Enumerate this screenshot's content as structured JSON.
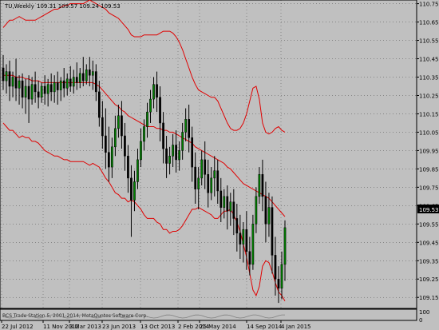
{
  "header": {
    "symbol_timeframe": "TU,Weekly",
    "ohlc": "109.31 109.57 109.24 109.53"
  },
  "footer": {
    "indicator_text": "BCS Trade Station 5, 2001-2014, MetaQuotes Software Corp."
  },
  "chart_data": {
    "type": "candlestick",
    "title": "TU,Weekly",
    "current_price": "109.53",
    "price_axis_ticks": [
      "110.75",
      "110.65",
      "110.55",
      "110.45",
      "110.35",
      "110.25",
      "110.15",
      "110.05",
      "109.95",
      "109.85",
      "109.75",
      "109.65",
      "109.55",
      "109.45",
      "109.35",
      "109.25",
      "109.15"
    ],
    "time_axis_ticks": [
      "22 Jul 2012",
      "11 Nov 2012",
      "3 Mar 2013",
      "23 Jun 2013",
      "13 Oct 2013",
      "2 Feb 2014",
      "25 May 2014",
      "14 Sep 2014",
      "4 Jan 2015"
    ],
    "subwindow_ticks": [
      "100",
      "0"
    ],
    "ylim": [
      109.09,
      110.77
    ],
    "candles": [
      {
        "o": 110.4,
        "h": 110.47,
        "c": 110.33,
        "l": 110.28
      },
      {
        "o": 110.33,
        "h": 110.42,
        "c": 110.38,
        "l": 110.26
      },
      {
        "o": 110.38,
        "h": 110.44,
        "c": 110.3,
        "l": 110.22
      },
      {
        "o": 110.3,
        "h": 110.38,
        "c": 110.35,
        "l": 110.24
      },
      {
        "o": 110.35,
        "h": 110.45,
        "c": 110.29,
        "l": 110.22
      },
      {
        "o": 110.29,
        "h": 110.36,
        "c": 110.33,
        "l": 110.2
      },
      {
        "o": 110.33,
        "h": 110.37,
        "c": 110.24,
        "l": 110.18
      },
      {
        "o": 110.24,
        "h": 110.34,
        "c": 110.3,
        "l": 110.15
      },
      {
        "o": 110.3,
        "h": 110.36,
        "c": 110.23,
        "l": 110.1
      },
      {
        "o": 110.23,
        "h": 110.35,
        "c": 110.31,
        "l": 110.2
      },
      {
        "o": 110.31,
        "h": 110.38,
        "c": 110.27,
        "l": 110.21
      },
      {
        "o": 110.27,
        "h": 110.33,
        "c": 110.24,
        "l": 110.18
      },
      {
        "o": 110.24,
        "h": 110.32,
        "c": 110.3,
        "l": 110.21
      },
      {
        "o": 110.3,
        "h": 110.36,
        "c": 110.26,
        "l": 110.2
      },
      {
        "o": 110.26,
        "h": 110.34,
        "c": 110.31,
        "l": 110.19
      },
      {
        "o": 110.31,
        "h": 110.37,
        "c": 110.27,
        "l": 110.22
      },
      {
        "o": 110.27,
        "h": 110.36,
        "c": 110.32,
        "l": 110.21
      },
      {
        "o": 110.32,
        "h": 110.38,
        "c": 110.28,
        "l": 110.2
      },
      {
        "o": 110.28,
        "h": 110.35,
        "c": 110.33,
        "l": 110.22
      },
      {
        "o": 110.33,
        "h": 110.4,
        "c": 110.29,
        "l": 110.24
      },
      {
        "o": 110.29,
        "h": 110.37,
        "c": 110.34,
        "l": 110.25
      },
      {
        "o": 110.34,
        "h": 110.41,
        "c": 110.3,
        "l": 110.27
      },
      {
        "o": 110.3,
        "h": 110.39,
        "c": 110.35,
        "l": 110.26
      },
      {
        "o": 110.35,
        "h": 110.43,
        "c": 110.32,
        "l": 110.28
      },
      {
        "o": 110.32,
        "h": 110.4,
        "c": 110.37,
        "l": 110.29
      },
      {
        "o": 110.37,
        "h": 110.46,
        "c": 110.33,
        "l": 110.3
      },
      {
        "o": 110.33,
        "h": 110.42,
        "c": 110.39,
        "l": 110.31
      },
      {
        "o": 110.39,
        "h": 110.46,
        "c": 110.36,
        "l": 110.3
      },
      {
        "o": 110.36,
        "h": 110.44,
        "c": 110.38,
        "l": 110.28
      },
      {
        "o": 110.38,
        "h": 110.42,
        "c": 110.27,
        "l": 110.22
      },
      {
        "o": 110.27,
        "h": 110.33,
        "c": 110.13,
        "l": 110.08
      },
      {
        "o": 110.13,
        "h": 110.22,
        "c": 110.03,
        "l": 109.96
      },
      {
        "o": 110.03,
        "h": 110.18,
        "c": 109.94,
        "l": 109.85
      },
      {
        "o": 109.94,
        "h": 110.08,
        "c": 109.86,
        "l": 109.78
      },
      {
        "o": 109.86,
        "h": 110.02,
        "c": 109.97,
        "l": 109.8
      },
      {
        "o": 109.97,
        "h": 110.14,
        "c": 110.07,
        "l": 109.92
      },
      {
        "o": 110.07,
        "h": 110.2,
        "c": 110.14,
        "l": 110.02
      },
      {
        "o": 110.14,
        "h": 110.22,
        "c": 110.03,
        "l": 109.96
      },
      {
        "o": 110.03,
        "h": 110.1,
        "c": 109.92,
        "l": 109.84
      },
      {
        "o": 109.92,
        "h": 109.98,
        "c": 109.8,
        "l": 109.72
      },
      {
        "o": 109.8,
        "h": 109.87,
        "c": 109.68,
        "l": 109.48
      },
      {
        "o": 109.68,
        "h": 109.84,
        "c": 109.78,
        "l": 109.62
      },
      {
        "o": 109.78,
        "h": 109.96,
        "c": 109.9,
        "l": 109.74
      },
      {
        "o": 109.9,
        "h": 110.07,
        "c": 110.0,
        "l": 109.86
      },
      {
        "o": 110.0,
        "h": 110.12,
        "c": 110.08,
        "l": 109.95
      },
      {
        "o": 110.08,
        "h": 110.21,
        "c": 110.16,
        "l": 110.02
      },
      {
        "o": 110.16,
        "h": 110.28,
        "c": 110.23,
        "l": 110.1
      },
      {
        "o": 110.23,
        "h": 110.35,
        "c": 110.31,
        "l": 110.18
      },
      {
        "o": 110.31,
        "h": 110.38,
        "c": 110.24,
        "l": 110.16
      },
      {
        "o": 110.24,
        "h": 110.3,
        "c": 110.1,
        "l": 110.0
      },
      {
        "o": 110.1,
        "h": 110.16,
        "c": 109.96,
        "l": 109.88
      },
      {
        "o": 109.96,
        "h": 110.03,
        "c": 109.88,
        "l": 109.8
      },
      {
        "o": 109.88,
        "h": 109.97,
        "c": 109.92,
        "l": 109.82
      },
      {
        "o": 109.92,
        "h": 110.04,
        "c": 109.98,
        "l": 109.86
      },
      {
        "o": 109.98,
        "h": 110.06,
        "c": 109.9,
        "l": 109.83
      },
      {
        "o": 109.9,
        "h": 110.0,
        "c": 109.95,
        "l": 109.84
      },
      {
        "o": 109.95,
        "h": 110.1,
        "c": 110.05,
        "l": 109.9
      },
      {
        "o": 110.05,
        "h": 110.18,
        "c": 110.12,
        "l": 110.0
      },
      {
        "o": 110.12,
        "h": 110.2,
        "c": 110.02,
        "l": 109.94
      },
      {
        "o": 110.02,
        "h": 110.08,
        "c": 109.86,
        "l": 109.78
      },
      {
        "o": 109.86,
        "h": 109.94,
        "c": 109.74,
        "l": 109.66
      },
      {
        "o": 109.74,
        "h": 109.86,
        "c": 109.8,
        "l": 109.63
      },
      {
        "o": 109.8,
        "h": 109.95,
        "c": 109.9,
        "l": 109.76
      },
      {
        "o": 109.9,
        "h": 110.0,
        "c": 109.82,
        "l": 109.74
      },
      {
        "o": 109.82,
        "h": 109.9,
        "c": 109.72,
        "l": 109.64
      },
      {
        "o": 109.72,
        "h": 109.86,
        "c": 109.8,
        "l": 109.68
      },
      {
        "o": 109.8,
        "h": 109.92,
        "c": 109.84,
        "l": 109.7
      },
      {
        "o": 109.84,
        "h": 109.9,
        "c": 109.73,
        "l": 109.66
      },
      {
        "o": 109.73,
        "h": 109.8,
        "c": 109.64,
        "l": 109.56
      },
      {
        "o": 109.64,
        "h": 109.74,
        "c": 109.7,
        "l": 109.58
      },
      {
        "o": 109.7,
        "h": 109.76,
        "c": 109.62,
        "l": 109.52
      },
      {
        "o": 109.62,
        "h": 109.72,
        "c": 109.67,
        "l": 109.54
      },
      {
        "o": 109.67,
        "h": 109.74,
        "c": 109.58,
        "l": 109.49
      },
      {
        "o": 109.58,
        "h": 109.66,
        "c": 109.5,
        "l": 109.4
      },
      {
        "o": 109.5,
        "h": 109.6,
        "c": 109.44,
        "l": 109.36
      },
      {
        "o": 109.44,
        "h": 109.56,
        "c": 109.52,
        "l": 109.34
      },
      {
        "o": 109.52,
        "h": 109.62,
        "c": 109.4,
        "l": 109.3
      },
      {
        "o": 109.4,
        "h": 109.48,
        "c": 109.33,
        "l": 109.27
      },
      {
        "o": 109.33,
        "h": 109.6,
        "c": 109.55,
        "l": 109.3
      },
      {
        "o": 109.55,
        "h": 109.75,
        "c": 109.7,
        "l": 109.5
      },
      {
        "o": 109.7,
        "h": 109.86,
        "c": 109.82,
        "l": 109.66
      },
      {
        "o": 109.82,
        "h": 109.9,
        "c": 109.7,
        "l": 109.62
      },
      {
        "o": 109.7,
        "h": 109.78,
        "c": 109.55,
        "l": 109.45
      },
      {
        "o": 109.55,
        "h": 109.72,
        "c": 109.64,
        "l": 109.48
      },
      {
        "o": 109.64,
        "h": 109.7,
        "c": 109.38,
        "l": 109.28
      },
      {
        "o": 109.38,
        "h": 109.48,
        "c": 109.25,
        "l": 109.16
      },
      {
        "o": 109.25,
        "h": 109.32,
        "c": 109.2,
        "l": 109.12
      },
      {
        "o": 109.2,
        "h": 109.4,
        "c": 109.33,
        "l": 109.14
      },
      {
        "o": 109.33,
        "h": 109.57,
        "c": 109.53,
        "l": 109.24
      }
    ],
    "bands": {
      "upper": [
        110.62,
        110.64,
        110.66,
        110.66,
        110.67,
        110.68,
        110.67,
        110.66,
        110.66,
        110.66,
        110.66,
        110.67,
        110.68,
        110.69,
        110.7,
        110.71,
        110.72,
        110.72,
        110.73,
        110.74,
        110.74,
        110.75,
        110.75,
        110.75,
        110.75,
        110.75,
        110.76,
        110.77,
        110.76,
        110.75,
        110.74,
        110.73,
        110.72,
        110.7,
        110.69,
        110.68,
        110.67,
        110.65,
        110.63,
        110.61,
        110.58,
        110.57,
        110.57,
        110.57,
        110.58,
        110.58,
        110.58,
        110.58,
        110.58,
        110.59,
        110.6,
        110.6,
        110.6,
        110.59,
        110.57,
        110.54,
        110.5,
        110.45,
        110.4,
        110.35,
        110.31,
        110.28,
        110.27,
        110.26,
        110.25,
        110.24,
        110.24,
        110.22,
        110.18,
        110.14,
        110.1,
        110.07,
        110.06,
        110.06,
        110.07,
        110.1,
        110.15,
        110.22,
        110.29,
        110.3,
        110.23,
        110.1,
        110.05,
        110.04,
        110.05,
        110.07,
        110.08,
        110.06,
        110.05
      ],
      "middle": [
        110.36,
        110.36,
        110.36,
        110.36,
        110.35,
        110.35,
        110.35,
        110.34,
        110.34,
        110.33,
        110.33,
        110.33,
        110.32,
        110.32,
        110.32,
        110.32,
        110.32,
        110.32,
        110.32,
        110.32,
        110.32,
        110.32,
        110.32,
        110.32,
        110.32,
        110.32,
        110.32,
        110.32,
        110.32,
        110.31,
        110.3,
        110.28,
        110.26,
        110.24,
        110.22,
        110.2,
        110.19,
        110.17,
        110.16,
        110.14,
        110.13,
        110.12,
        110.11,
        110.1,
        110.09,
        110.08,
        110.08,
        110.08,
        110.07,
        110.07,
        110.06,
        110.06,
        110.05,
        110.05,
        110.04,
        110.03,
        110.02,
        110.01,
        110.0,
        109.99,
        109.97,
        109.96,
        109.95,
        109.94,
        109.93,
        109.92,
        109.91,
        109.9,
        109.89,
        109.88,
        109.86,
        109.85,
        109.83,
        109.81,
        109.79,
        109.77,
        109.76,
        109.75,
        109.74,
        109.73,
        109.72,
        109.71,
        109.7,
        109.69,
        109.67,
        109.65,
        109.63,
        109.61,
        109.59
      ],
      "lower": [
        110.1,
        110.08,
        110.06,
        110.06,
        110.04,
        110.02,
        110.03,
        110.02,
        110.02,
        110.0,
        110.0,
        109.99,
        109.97,
        109.95,
        109.94,
        109.93,
        109.92,
        109.92,
        109.91,
        109.9,
        109.9,
        109.89,
        109.89,
        109.89,
        109.89,
        109.89,
        109.88,
        109.87,
        109.88,
        109.87,
        109.86,
        109.83,
        109.8,
        109.78,
        109.75,
        109.72,
        109.71,
        109.69,
        109.69,
        109.67,
        109.68,
        109.67,
        109.65,
        109.63,
        109.6,
        109.58,
        109.58,
        109.58,
        109.56,
        109.55,
        109.52,
        109.52,
        109.5,
        109.51,
        109.51,
        109.52,
        109.54,
        109.57,
        109.6,
        109.63,
        109.63,
        109.64,
        109.63,
        109.62,
        109.61,
        109.6,
        109.58,
        109.58,
        109.6,
        109.62,
        109.62,
        109.63,
        109.6,
        109.56,
        109.51,
        109.44,
        109.37,
        109.28,
        109.19,
        109.16,
        109.21,
        109.32,
        109.35,
        109.34,
        109.29,
        109.23,
        109.18,
        109.16,
        109.13
      ]
    },
    "grid": true,
    "legend": "none"
  }
}
